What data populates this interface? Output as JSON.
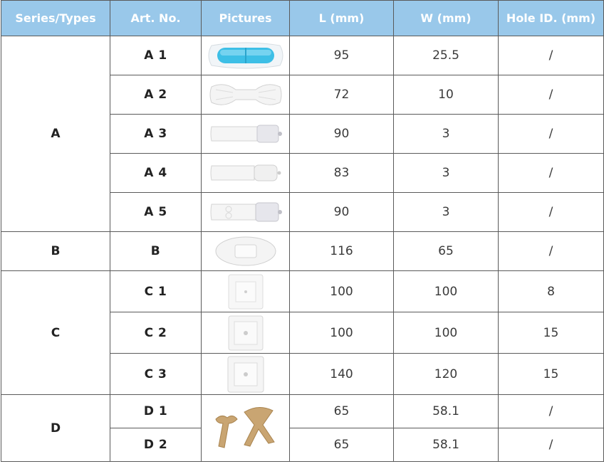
{
  "columns": [
    "Series/Types",
    "Art. No.",
    "Pictures",
    "L (mm)",
    "W (mm)",
    "Hole ID. (mm)"
  ],
  "groups": [
    {
      "series": "A",
      "items": [
        {
          "art": "A 1",
          "image": "blue-gel-pad-icon",
          "L": "95",
          "W": "25.5",
          "hole": "/"
        },
        {
          "art": "A 2",
          "image": "butterfly-strip-icon",
          "L": "72",
          "W": "10",
          "hole": "/"
        },
        {
          "art": "A 3",
          "image": "strip-with-tab-icon",
          "L": "90",
          "W": "3",
          "hole": "/"
        },
        {
          "art": "A 4",
          "image": "strip-with-tab-icon",
          "L": "83",
          "W": "3",
          "hole": "/"
        },
        {
          "art": "A 5",
          "image": "strip-with-tab-icon",
          "L": "90",
          "W": "3",
          "hole": "/"
        }
      ]
    },
    {
      "series": "B",
      "items": [
        {
          "art": "B",
          "image": "oval-pad-icon",
          "L": "116",
          "W": "65",
          "hole": "/"
        }
      ]
    },
    {
      "series": "C",
      "items": [
        {
          "art": "C 1",
          "image": "square-dressing-icon",
          "L": "100",
          "W": "100",
          "hole": "8"
        },
        {
          "art": "C 2",
          "image": "square-dressing-icon",
          "L": "100",
          "W": "100",
          "hole": "15"
        },
        {
          "art": "C 3",
          "image": "square-dressing-icon",
          "L": "140",
          "W": "120",
          "hole": "15"
        }
      ]
    },
    {
      "series": "D",
      "items": [
        {
          "art": "D 1",
          "image": "tan-shaped-strips-icon",
          "L": "65",
          "W": "58.1",
          "hole": "/"
        },
        {
          "art": "D 2",
          "image": "tan-shaped-strips-icon",
          "L": "65",
          "W": "58.1",
          "hole": "/"
        }
      ]
    }
  ],
  "colors": {
    "header_bg": "#99c8ea",
    "header_text": "#ffffff",
    "border": "#5a5a5a",
    "text": "#3a3a3a"
  }
}
